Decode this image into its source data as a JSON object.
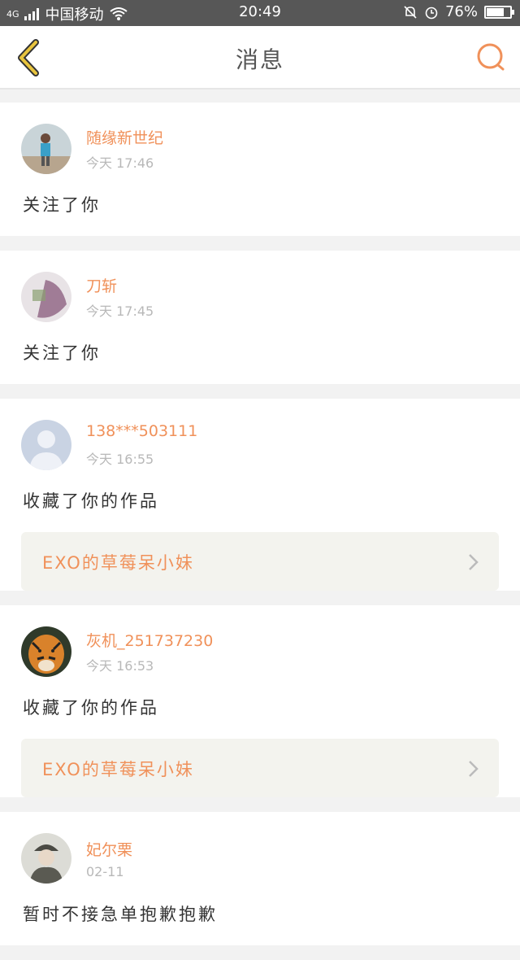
{
  "status_bar": {
    "network": "4G",
    "carrier": "中国移动",
    "time": "20:49",
    "battery": "76%",
    "battery_level": 0.76
  },
  "header": {
    "title": "消息"
  },
  "colors": {
    "accent": "#f0915a",
    "back_icon": "#e8c43e",
    "status_bar": "#575757"
  },
  "messages": [
    {
      "name": "随缘新世纪",
      "time": "今天 17:46",
      "action": "关注了你",
      "avatar": "photo-person"
    },
    {
      "name": "刀斩",
      "time": "今天 17:45",
      "action": "关注了你",
      "avatar": "photo-art"
    },
    {
      "name": "138***503111",
      "time": "今天 16:55",
      "action": "收藏了你的作品",
      "avatar": "default-person-icon",
      "work": "EXO的草莓呆小妹"
    },
    {
      "name": "灰机_251737230",
      "time": "今天 16:53",
      "action": "收藏了你的作品",
      "avatar": "tiger-photo",
      "work": "EXO的草莓呆小妹"
    },
    {
      "name": "妃尔栗",
      "time": "02-11",
      "action": "暂时不接急单抱歉抱歉",
      "avatar": "photo-person-hat"
    }
  ]
}
